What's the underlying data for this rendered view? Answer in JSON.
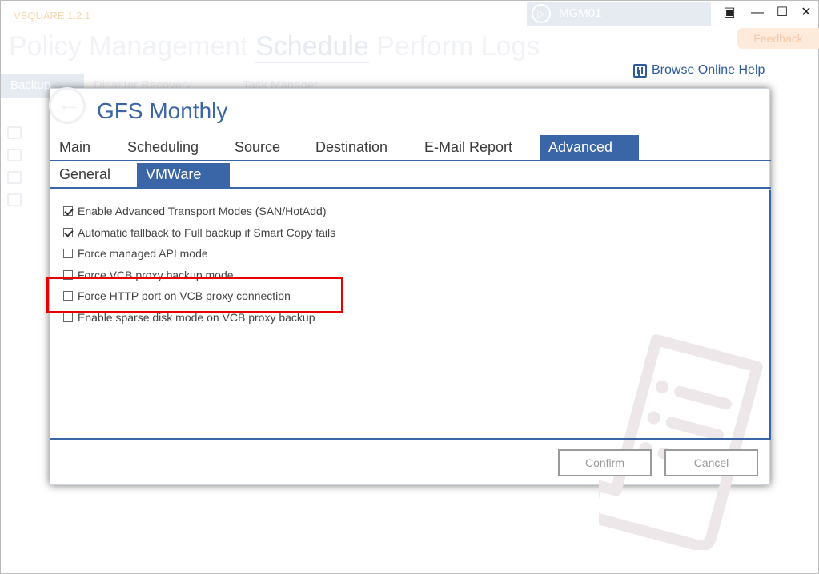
{
  "app": {
    "version": "VSQUARE 1.2.1",
    "server": "MGM01",
    "feedback": "Feedback",
    "help": "Browse Online Help",
    "nav": [
      "Policy Management",
      "Schedule",
      "Perform Logs"
    ],
    "tabs": [
      "Backup",
      "Disaster Recovery",
      "Task Manager"
    ]
  },
  "dialog": {
    "title": "GFS Monthly",
    "tabs": [
      "Main",
      "Scheduling",
      "Source",
      "Destination",
      "E-Mail Report",
      "Advanced"
    ],
    "active_tab": "Advanced",
    "subtabs": [
      "General",
      "VMWare"
    ],
    "active_subtab": "VMWare",
    "options": [
      {
        "label": "Enable Advanced Transport Modes (SAN/HotAdd)",
        "checked": true
      },
      {
        "label": "Automatic fallback to Full backup if Smart Copy fails",
        "checked": true
      },
      {
        "label": "Force managed API mode",
        "checked": false
      },
      {
        "label": "Force VCB proxy backup mode",
        "checked": false
      },
      {
        "label": "Force HTTP port on VCB proxy connection",
        "checked": false
      },
      {
        "label": "Enable sparse disk mode on VCB proxy backup",
        "checked": false
      }
    ],
    "highlighted_option": "Force HTTP port on VCB proxy connection",
    "buttons": {
      "confirm": "Confirm",
      "cancel": "Cancel"
    }
  },
  "colors": {
    "accent": "#3a65a6",
    "highlight": "#e60000",
    "watermark": "#ede7ea"
  },
  "icons": {
    "help": "help-book-icon",
    "server": "server-arrow-icon",
    "back": "back-arrow-icon",
    "watermark": "report-document-icon"
  }
}
